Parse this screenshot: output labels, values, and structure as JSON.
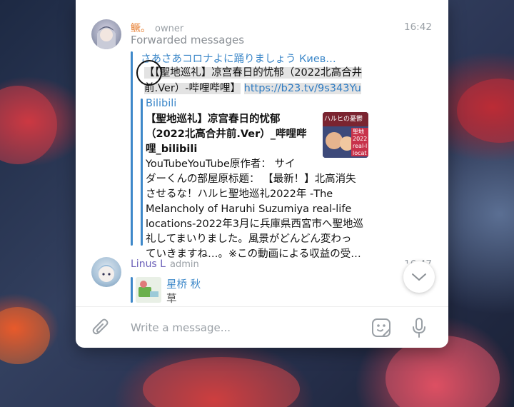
{
  "message": {
    "sender_name": "鳜。",
    "sender_role": "owner",
    "time": "16:42",
    "forwarded_label": "Forwarded messages",
    "quote_author": "さあさあコロナよに踊りましょう Киев…",
    "selected_text_line1": "【【聖地巡礼】凉宫春日的忧郁（2022北高合井",
    "selected_text_line2_plain": "前.Ver）-哔哩哔哩】",
    "selected_text_link": "https://b23.tv/9s343Yu",
    "preview": {
      "site": "Bilibili",
      "title_line1": "【聖地巡礼】凉宫春日的忧郁",
      "title_line2": "（2022北高合井前.Ver）_哔哩哔",
      "title_line3": "哩_bilibili",
      "body_line1": "YouTubeYouTube原作者：  サイ",
      "body_line2": "ダーくんの部屋原标题：  【最新！】北高消失",
      "body_line3": "させるな！ハルヒ聖地巡礼2022年    -The",
      "body_line4": "Melancholy of Haruhi Suzumiya real-life",
      "body_line5": "locations-2022年3月に兵庫県西宮市へ聖地巡",
      "body_line6": "礼してまいりました。風景がどんどん変わっ",
      "body_line7": "ていきますね…。※この動画による収益の受…",
      "thumb_text": "ハルヒの憂鬱 聖地 2022 real-l locat"
    }
  },
  "next_message": {
    "sender_name": "Linus L",
    "sender_role": "admin",
    "time_partial": "16:47",
    "reply_name": "星桥 秋",
    "reply_text": "草"
  },
  "composer": {
    "placeholder": "Write a message..."
  },
  "icons": {
    "attach": "paperclip-icon",
    "emoji": "sticker-face-icon",
    "mic": "microphone-icon",
    "scroll_down": "chevron-down-icon"
  },
  "colors": {
    "accent": "#3a86c8",
    "owner_name": "#e8843a",
    "admin_name": "#6a5fb8",
    "selection": "#e3e3e3"
  }
}
